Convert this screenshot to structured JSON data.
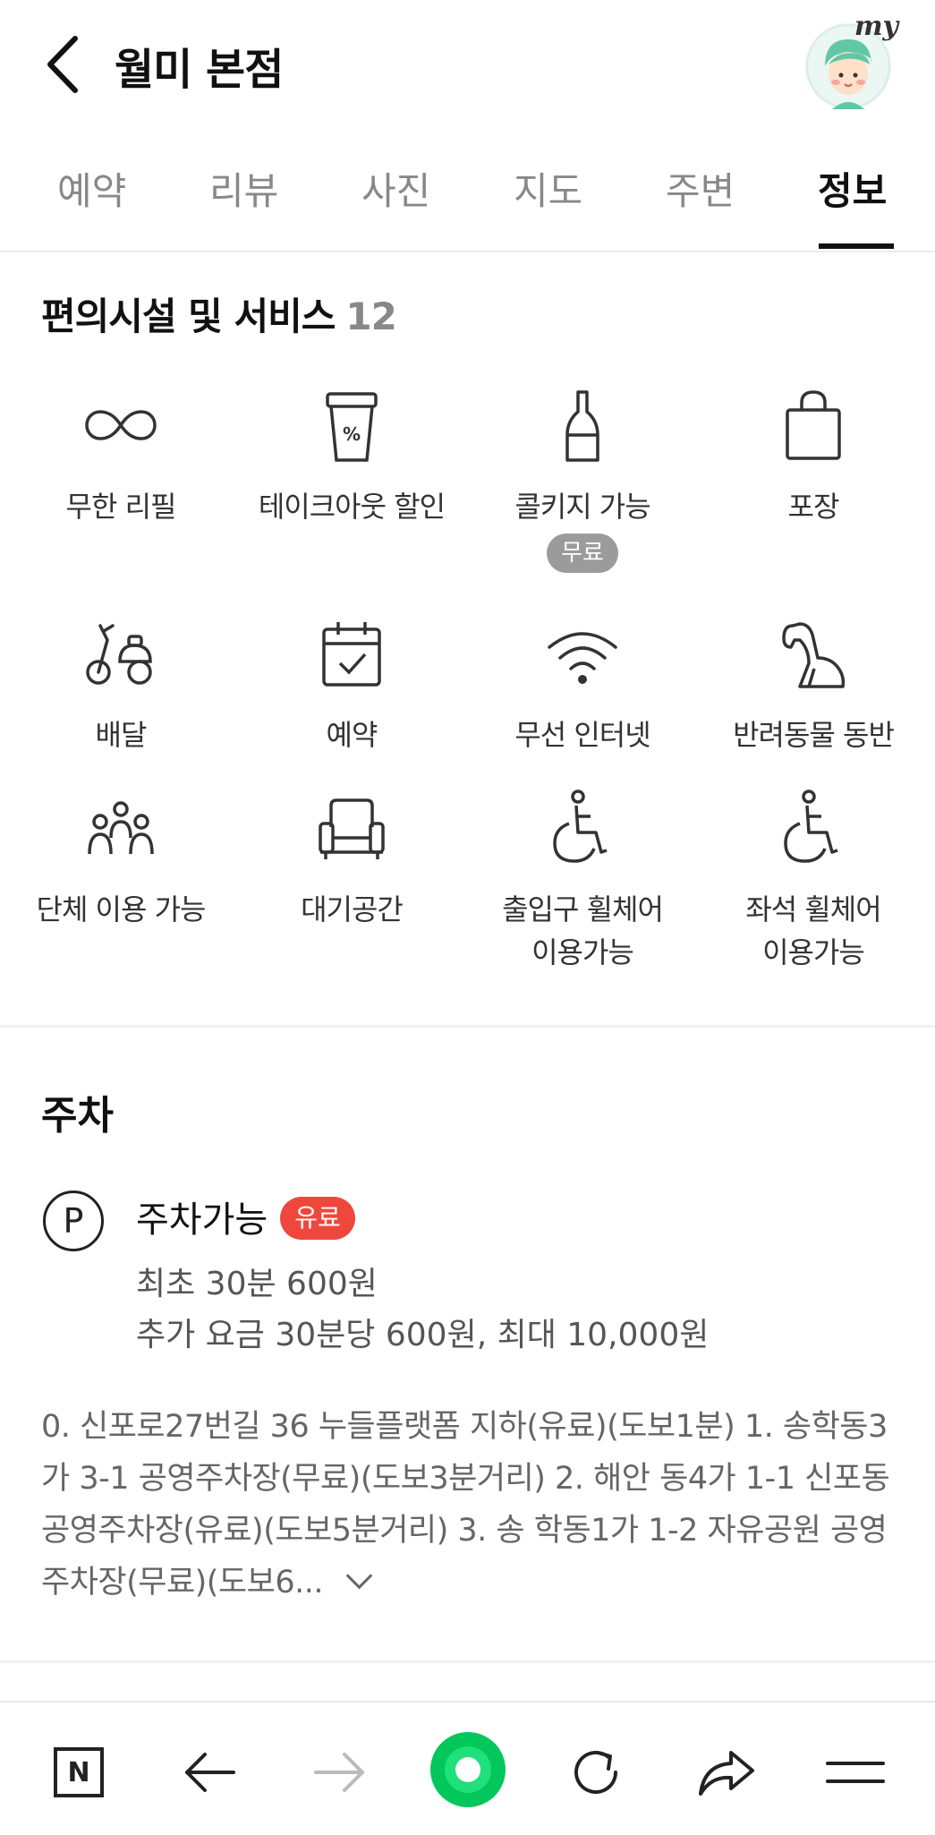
{
  "header": {
    "title": "월미 본점",
    "avatar_label": "my"
  },
  "tabs": [
    {
      "label": "예약"
    },
    {
      "label": "리뷰"
    },
    {
      "label": "사진"
    },
    {
      "label": "지도"
    },
    {
      "label": "주변"
    },
    {
      "label": "정보"
    }
  ],
  "active_tab": "정보",
  "amenities": {
    "title": "편의시설 및 서비스",
    "count": "12",
    "items": [
      {
        "label": "무한 리필",
        "icon": "infinity-icon"
      },
      {
        "label": "테이크아웃 할인",
        "icon": "takeout-cup-icon"
      },
      {
        "label": "콜키지 가능",
        "icon": "wine-bottle-icon",
        "badge": "무료"
      },
      {
        "label": "포장",
        "icon": "shopping-bag-icon"
      },
      {
        "label": "배달",
        "icon": "scooter-icon"
      },
      {
        "label": "예약",
        "icon": "calendar-check-icon"
      },
      {
        "label": "무선 인터넷",
        "icon": "wifi-icon"
      },
      {
        "label": "반려동물 동반",
        "icon": "dog-icon"
      },
      {
        "label": "단체 이용 가능",
        "icon": "group-icon"
      },
      {
        "label": "대기공간",
        "icon": "armchair-icon"
      },
      {
        "label_line1": "출입구 휠체어",
        "label_line2": "이용가능",
        "icon": "wheelchair-icon"
      },
      {
        "label_line1": "좌석 휠체어",
        "label_line2": "이용가능",
        "icon": "wheelchair-icon"
      }
    ]
  },
  "parking": {
    "title": "주차",
    "icon_letter": "P",
    "status": "주차가능",
    "badge": "유료",
    "detail1": "최초 30분 600원",
    "detail2": "추가 요금 30분당 600원, 최대 10,000원",
    "description": "0. 신포로27번길 36 누들플랫폼 지하(유료)(도보1분) 1. 송학동3가 3-1 공영주차장(무료)(도보3분거리) 2. 해안 동4가 1-1 신포동공영주차장(유료)(도보5분거리) 3. 송 학동1가 1-2 자유공원 공영주차장(무료)(도보6..."
  },
  "bottom_bar": {
    "icons": [
      "naver-home-icon",
      "back-arrow-icon",
      "forward-arrow-icon",
      "green-dot-icon",
      "refresh-icon",
      "share-icon",
      "menu-icon"
    ],
    "home_letter": "N"
  },
  "colors": {
    "accent_green": "#03c75a",
    "paid_red": "#f0473c",
    "free_gray": "#9b9b9b"
  }
}
